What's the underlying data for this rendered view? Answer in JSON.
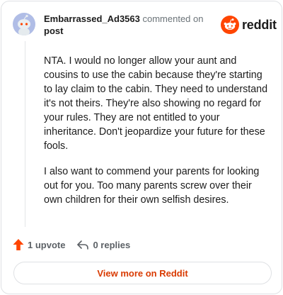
{
  "comment": {
    "username": "Embarrassed_Ad3563",
    "action_text": "commented on",
    "target_label": "post",
    "paragraphs": [
      "NTA. I would no longer allow your aunt and cousins to use the cabin because they're starting to lay claim to the cabin. They need to understand it's not theirs. They're also showing no regard for your rules. They are not entitled to your inheritance. Don't jeopardize your future for these fools.",
      "I also want to commend your parents for looking out for you. Too many parents screw over their own children for their own selfish desires."
    ],
    "upvotes_label": "1 upvote",
    "replies_label": "0 replies"
  },
  "brand": {
    "name": "reddit",
    "accent_color": "#ff4500"
  },
  "footer": {
    "view_more_label": "View more on Reddit"
  },
  "icons": {
    "avatar": "snoo-avatar",
    "logo": "reddit-snoo-icon",
    "upvote": "upvote-arrow-icon",
    "reply": "reply-arrow-icon"
  }
}
